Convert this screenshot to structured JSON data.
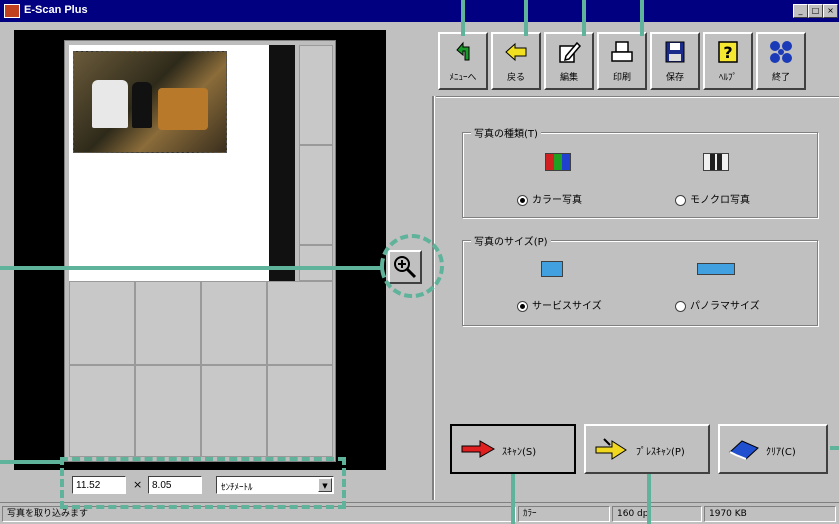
{
  "window": {
    "title": "E-Scan Plus",
    "btn_min": "_",
    "btn_max": "□",
    "btn_close": "×"
  },
  "toolbar": [
    {
      "label": "ﾒﾆｭｰへ",
      "icon": "menu-return-arrow-icon"
    },
    {
      "label": "戻る",
      "icon": "back-arrow-icon"
    },
    {
      "label": "編集",
      "icon": "edit-pen-icon"
    },
    {
      "label": "印刷",
      "icon": "printer-icon"
    },
    {
      "label": "保存",
      "icon": "floppy-disk-icon"
    },
    {
      "label": "ﾍﾙﾌﾟ",
      "icon": "help-question-icon"
    },
    {
      "label": "終了",
      "icon": "exit-icon"
    }
  ],
  "photo_type": {
    "title": "写真の種類(T)",
    "options": [
      {
        "label": "カラー写真",
        "selected": true,
        "icon": "color-photo-icon"
      },
      {
        "label": "モノクロ写真",
        "selected": false,
        "icon": "monochrome-photo-icon"
      }
    ]
  },
  "photo_size": {
    "title": "写真のサイズ(P)",
    "options": [
      {
        "label": "サービスサイズ",
        "selected": true,
        "icon": "service-size-icon"
      },
      {
        "label": "パノラマサイズ",
        "selected": false,
        "icon": "panorama-size-icon"
      }
    ]
  },
  "actions": {
    "scan": "ｽｷｬﾝ(S)",
    "prescan": "ﾌﾟﾚｽｷｬﾝ(P)",
    "clear": "ｸﾘｱ(C)"
  },
  "dimensions": {
    "width": "11.52",
    "height": "8.05",
    "times": "×",
    "unit": "ｾﾝﾁﾒｰﾄﾙ"
  },
  "status": {
    "message": "写真を取り込みます",
    "mode": "ｶﾗｰ",
    "dpi": "160 dpi",
    "size": "1970 KB"
  },
  "colors": {
    "callout": "#5fb39a",
    "titlebar": "#000080"
  }
}
